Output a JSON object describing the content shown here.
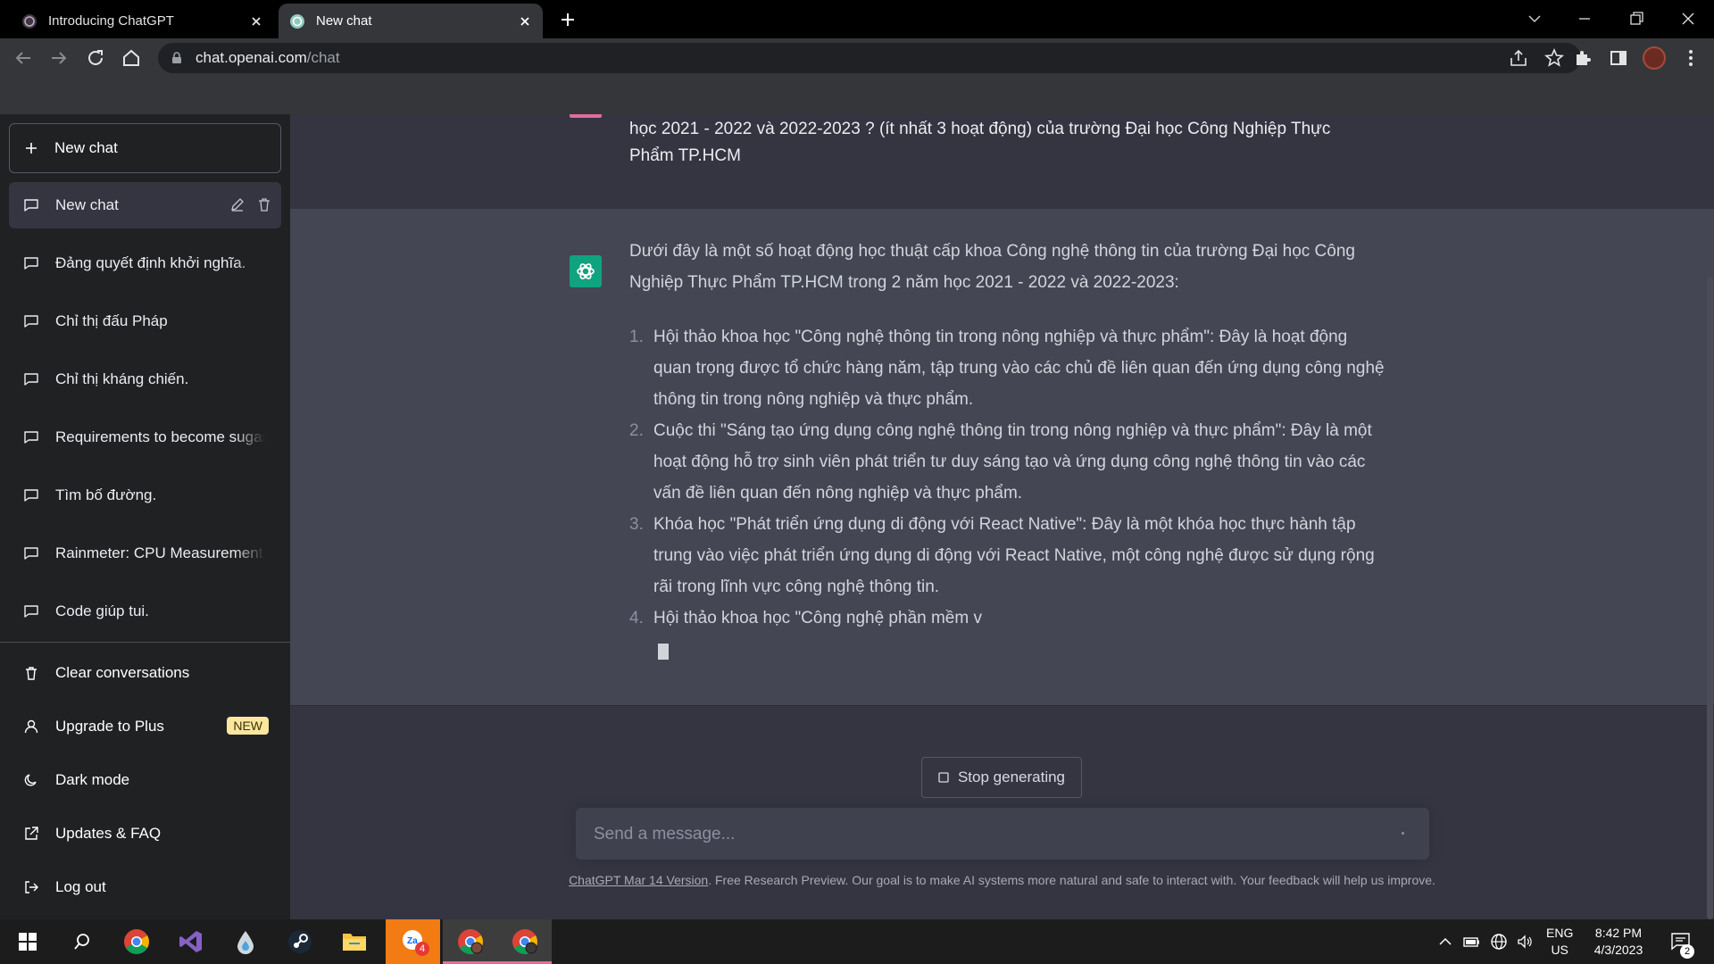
{
  "browser": {
    "tabs": [
      {
        "title": "Introducing ChatGPT",
        "active": false
      },
      {
        "title": "New chat",
        "active": true
      }
    ],
    "url_host": "chat.openai.com",
    "url_path": "/chat"
  },
  "sidebar": {
    "new_chat_label": "New chat",
    "history": [
      {
        "label": "New chat",
        "selected": true
      },
      {
        "label": "Đảng quyết định khởi nghĩa.",
        "selected": false
      },
      {
        "label": "Chỉ thị đấu Pháp",
        "selected": false
      },
      {
        "label": "Chỉ thị kháng chiến.",
        "selected": false
      },
      {
        "label": "Requirements to become sugar",
        "selected": false
      },
      {
        "label": "Tìm bố đường.",
        "selected": false
      },
      {
        "label": "Rainmeter: CPU Measurement",
        "selected": false
      },
      {
        "label": "Code giúp tui.",
        "selected": false
      }
    ],
    "bottom": {
      "clear": "Clear conversations",
      "upgrade": "Upgrade to Plus",
      "upgrade_badge": "NEW",
      "dark_mode": "Dark mode",
      "updates": "Updates & FAQ",
      "logout": "Log out"
    }
  },
  "conversation": {
    "user_message": "học 2021 - 2022 và 2022-2023 ? (ít nhất 3 hoạt động) của trường Đại học Công Nghiệp Thực Phẩm TP.HCM",
    "assistant_intro": "Dưới đây là một số hoạt động học thuật cấp khoa Công nghệ thông tin của trường Đại học Công Nghiệp Thực Phẩm TP.HCM trong 2 năm học 2021 - 2022 và 2022-2023:",
    "assistant_items": [
      {
        "num": "1.",
        "text": "Hội thảo khoa học \"Công nghệ thông tin trong nông nghiệp và thực phẩm\": Đây là hoạt động quan trọng được tổ chức hàng năm, tập trung vào các chủ đề liên quan đến ứng dụng công nghệ thông tin trong nông nghiệp và thực phẩm."
      },
      {
        "num": "2.",
        "text": "Cuộc thi \"Sáng tạo ứng dụng công nghệ thông tin trong nông nghiệp và thực phẩm\": Đây là một hoạt động hỗ trợ sinh viên phát triển tư duy sáng tạo và ứng dụng công nghệ thông tin vào các vấn đề liên quan đến nông nghiệp và thực phẩm."
      },
      {
        "num": "3.",
        "text": "Khóa học \"Phát triển ứng dụng di động với React Native\": Đây là một khóa học thực hành tập trung vào việc phát triển ứng dụng di động với React Native, một công nghệ được sử dụng rộng rãi trong lĩnh vực công nghệ thông tin."
      },
      {
        "num": "4.",
        "text": "Hội thảo khoa học \"Công nghệ phần mềm v"
      }
    ]
  },
  "composer": {
    "stop_label": "Stop generating",
    "placeholder": "Send a message...",
    "footer_link": "ChatGPT Mar 14 Version",
    "footer_text": ". Free Research Preview. Our goal is to make AI systems more natural and safe to interact with. Your feedback will help us improve."
  },
  "taskbar": {
    "lang_top": "ENG",
    "lang_bottom": "US",
    "time": "8:42 PM",
    "date": "4/3/2023",
    "zalo_badge": "4",
    "notification_count": "2"
  },
  "colors": {
    "sidebar_bg": "#202123",
    "main_bg": "#343541",
    "assistant_bg": "#444654",
    "accent_green": "#10a37f",
    "badge_yellow": "#fae69e"
  }
}
